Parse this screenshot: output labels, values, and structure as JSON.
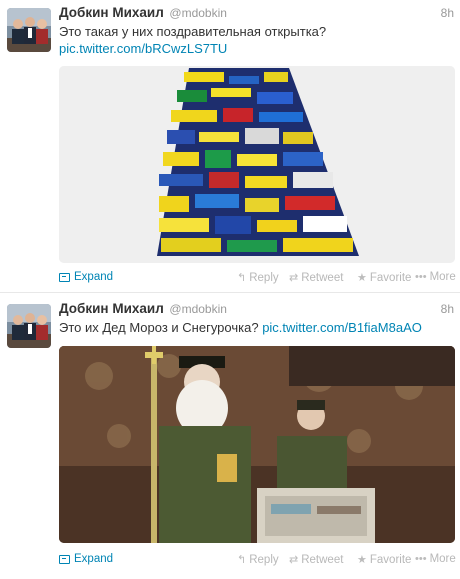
{
  "tweets": [
    {
      "fullname": "Добкин Михаил",
      "username": "@mdobkin",
      "time": "8h",
      "text_line1": "Это такая у них поздравительная открытка?",
      "text_link": "pic.twitter.com/bRCwzLS7TU",
      "actions": {
        "expand": "Expand",
        "reply": "Reply",
        "retweet": "Retweet",
        "favorite": "Favorite",
        "more": "More"
      }
    },
    {
      "fullname": "Добкин Михаил",
      "username": "@mdobkin",
      "time": "8h",
      "text_line1": "Это их Дед Мороз и Снегурочка?",
      "text_link": "pic.twitter.com/B1fiaM8aAO",
      "actions": {
        "expand": "Expand",
        "reply": "Reply",
        "retweet": "Retweet",
        "favorite": "Favorite",
        "more": "More"
      }
    }
  ],
  "colors": {
    "link": "#0084b4",
    "muted": "#999999",
    "text": "#333333"
  },
  "icons": [
    "expand-icon",
    "reply-icon",
    "retweet-icon",
    "favorite-icon",
    "more-icon"
  ]
}
